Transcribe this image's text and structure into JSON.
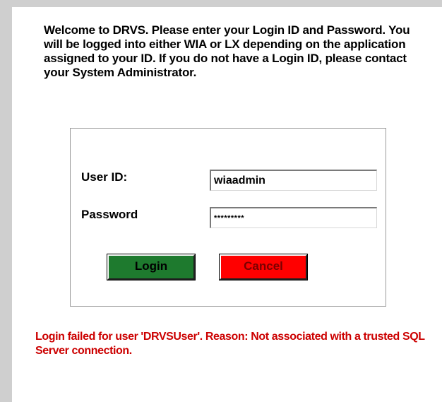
{
  "welcome_text": "Welcome to DRVS. Please enter your Login ID and Password. You will be logged into either WIA or LX depending on the application assigned to your ID.  If you do not have a Login ID, please contact your System Administrator.",
  "form": {
    "user_id_label": "User ID:",
    "user_id_value": "wiaadmin",
    "password_label": "Password",
    "password_value": "*********",
    "login_label": "Login",
    "cancel_label": "Cancel"
  },
  "error_message": "Login failed for user 'DRVSUser'. Reason: Not associated with a trusted SQL Server connection.",
  "colors": {
    "login_button": "#1e7a2e",
    "cancel_button": "#ff0000",
    "error_text": "#cc0000"
  }
}
